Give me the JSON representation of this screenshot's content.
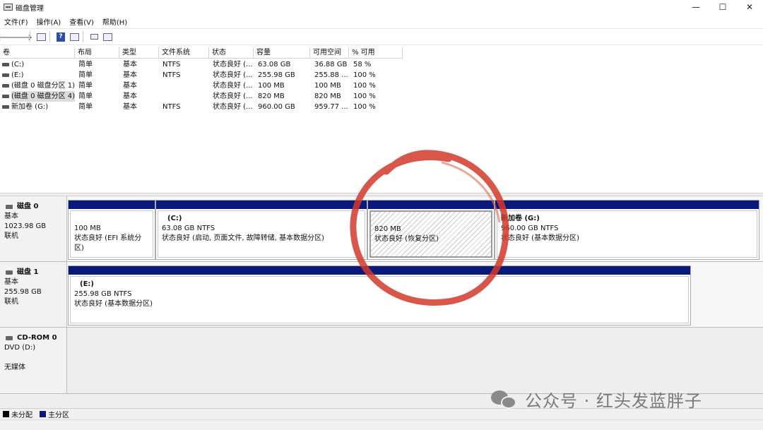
{
  "window": {
    "title": "磁盘管理",
    "minimize": "—",
    "maximize": "☐",
    "close": "✕"
  },
  "menu": [
    "文件(F)",
    "操作(A)",
    "查看(V)",
    "帮助(H)"
  ],
  "toolbar": {
    "back": "🡐",
    "forward": "🡒",
    "help": "?"
  },
  "columns": [
    "卷",
    "布局",
    "类型",
    "文件系统",
    "状态",
    "容量",
    "可用空间",
    "% 可用"
  ],
  "volumes": [
    {
      "name": "(C:)",
      "layout": "简单",
      "type": "基本",
      "fs": "NTFS",
      "status": "状态良好 (...",
      "capacity": "63.08 GB",
      "free": "36.88 GB",
      "pct": "58 %"
    },
    {
      "name": "(E:)",
      "layout": "简单",
      "type": "基本",
      "fs": "NTFS",
      "status": "状态良好 (...",
      "capacity": "255.98 GB",
      "free": "255.88 ...",
      "pct": "100 %"
    },
    {
      "name": "(磁盘 0 磁盘分区 1)",
      "layout": "简单",
      "type": "基本",
      "fs": "",
      "status": "状态良好 (...",
      "capacity": "100 MB",
      "free": "100 MB",
      "pct": "100 %"
    },
    {
      "name": "(磁盘 0 磁盘分区 4)",
      "layout": "简单",
      "type": "基本",
      "fs": "",
      "status": "状态良好 (...",
      "capacity": "820 MB",
      "free": "820 MB",
      "pct": "100 %"
    },
    {
      "name": "新加卷 (G:)",
      "layout": "简单",
      "type": "基本",
      "fs": "NTFS",
      "status": "状态良好 (...",
      "capacity": "960.00 GB",
      "free": "959.77 ...",
      "pct": "100 %"
    }
  ],
  "disks": [
    {
      "name": "磁盘 0",
      "kind": "基本",
      "size": "1023.98 GB",
      "state": "联机",
      "partitions": [
        {
          "title": "",
          "line1": "100 MB",
          "line2": "状态良好 (EFI 系统分区)"
        },
        {
          "title": "(C:)",
          "line1": "63.08 GB NTFS",
          "line2": "状态良好 (启动, 页面文件, 故障转储, 基本数据分区)"
        },
        {
          "title": "",
          "line1": "820 MB",
          "line2": "状态良好 (恢复分区)"
        },
        {
          "title": "新加卷 (G:)",
          "line1": "960.00 GB NTFS",
          "line2": "状态良好 (基本数据分区)"
        }
      ]
    },
    {
      "name": "磁盘 1",
      "kind": "基本",
      "size": "255.98 GB",
      "state": "联机",
      "partitions": [
        {
          "title": "(E:)",
          "line1": "255.98 GB NTFS",
          "line2": "状态良好 (基本数据分区)"
        }
      ]
    },
    {
      "name": "CD-ROM 0",
      "kind": "DVD (D:)",
      "size": "",
      "state": "无媒体",
      "partitions": []
    }
  ],
  "legend": [
    {
      "label": "未分配",
      "color": "#000000"
    },
    {
      "label": "主分区",
      "color": "#0a1a7a"
    }
  ],
  "watermark": "公众号 · 红头发蓝胖子",
  "colors": {
    "primary_partition": "#0a1a7a",
    "annotation": "#d13a2a"
  }
}
